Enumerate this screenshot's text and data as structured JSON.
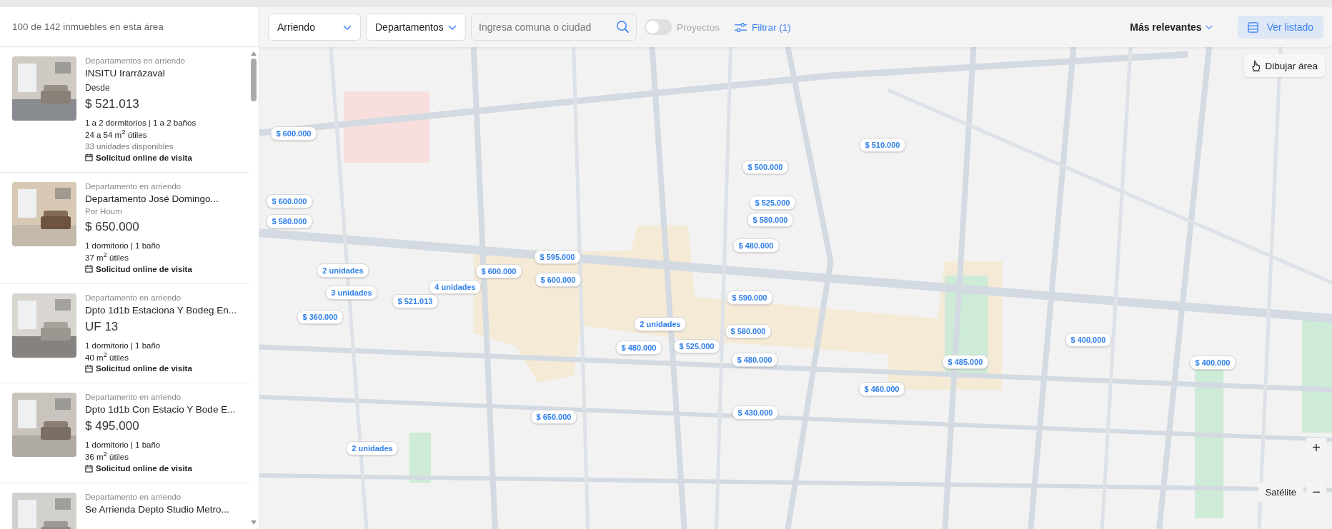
{
  "results_summary": "100 de 142 inmuebles en esta área",
  "listings": [
    {
      "category": "Departamentos en arriendo",
      "title": "INSITU Irarrázaval",
      "price_prefix": "Desde",
      "price": "$ 521.013",
      "rooms": "1 a 2 dormitorios | 1 a 2 baños",
      "area": "24 a 54 m$^{2}$ útiles",
      "availability": "33 unidades disponibles",
      "visit": "Solicitud online de visita"
    },
    {
      "category": "Departamento en arriendo",
      "title": "Departamento José Domingo...",
      "publisher": "Por Houm",
      "price": "$ 650.000",
      "rooms": "1 dormitorio | 1 baño",
      "area": "37 m$^{2}$ útiles",
      "visit": "Solicitud online de visita"
    },
    {
      "category": "Departamento en arriendo",
      "title": "Dpto 1d1b Estaciona Y Bodeg En...",
      "price": "UF 13",
      "rooms": "1 dormitorio | 1 baño",
      "area": "40 m$^{2}$ útiles",
      "visit": "Solicitud online de visita"
    },
    {
      "category": "Departamento en arriendo",
      "title": "Dpto 1d1b Con Estacio Y Bode E...",
      "price": "$ 495.000",
      "rooms": "1 dormitorio | 1 baño",
      "area": "36 m$^{2}$ útiles",
      "visit": "Solicitud online de visita"
    },
    {
      "category": "Departamento en arriendo",
      "title": "Se Arrienda Depto Studio Metro..."
    }
  ],
  "filters": {
    "operation": "Arriendo",
    "property_type": "Departamentos",
    "search": {
      "placeholder": "Ingresa comuna o ciudad"
    },
    "projects_toggle": {
      "label": "Proyectos",
      "on": false
    },
    "filter_button": "Filtrar (1)"
  },
  "sort": "Más relevantes",
  "view_list_button": "Ver listado",
  "map": {
    "kind": "picture",
    "draw_area_button": "Dibujar área",
    "zoom_in": "+",
    "zoom_out": "−",
    "satellite_button": "Satélite",
    "pins": [
      "$ 600.000",
      "$ 600.000",
      "$ 580.000",
      "$ 500.000",
      "$ 525.000",
      "$ 580.000",
      "$ 480.000",
      "$ 510.000",
      "2 unidades",
      "3 unidades",
      "$ 521.013",
      "4 unidades",
      "$ 600.000",
      "$ 595.000",
      "$ 600.000",
      "$ 360.000",
      "$ 590.000",
      "2 unidades",
      "$ 580.000",
      "$ 480.000",
      "$ 525.000",
      "$ 480.000",
      "$ 485.000",
      "$ 460.000",
      "$ 400.000",
      "$ 400.000",
      "$ 650.000",
      "$ 430.000",
      "2 unidades"
    ]
  }
}
